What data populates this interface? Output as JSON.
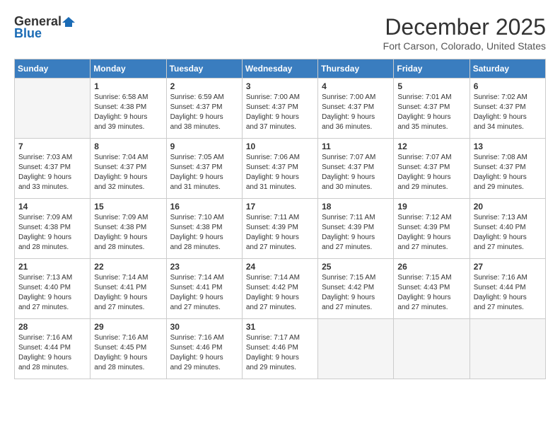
{
  "header": {
    "logo_line1": "General",
    "logo_line2": "Blue",
    "month": "December 2025",
    "location": "Fort Carson, Colorado, United States"
  },
  "days_of_week": [
    "Sunday",
    "Monday",
    "Tuesday",
    "Wednesday",
    "Thursday",
    "Friday",
    "Saturday"
  ],
  "weeks": [
    [
      {
        "day": "",
        "empty": true
      },
      {
        "day": "1",
        "sunrise": "6:58 AM",
        "sunset": "4:38 PM",
        "daylight": "9 hours and 39 minutes."
      },
      {
        "day": "2",
        "sunrise": "6:59 AM",
        "sunset": "4:37 PM",
        "daylight": "9 hours and 38 minutes."
      },
      {
        "day": "3",
        "sunrise": "7:00 AM",
        "sunset": "4:37 PM",
        "daylight": "9 hours and 37 minutes."
      },
      {
        "day": "4",
        "sunrise": "7:00 AM",
        "sunset": "4:37 PM",
        "daylight": "9 hours and 36 minutes."
      },
      {
        "day": "5",
        "sunrise": "7:01 AM",
        "sunset": "4:37 PM",
        "daylight": "9 hours and 35 minutes."
      },
      {
        "day": "6",
        "sunrise": "7:02 AM",
        "sunset": "4:37 PM",
        "daylight": "9 hours and 34 minutes."
      }
    ],
    [
      {
        "day": "7",
        "sunrise": "7:03 AM",
        "sunset": "4:37 PM",
        "daylight": "9 hours and 33 minutes."
      },
      {
        "day": "8",
        "sunrise": "7:04 AM",
        "sunset": "4:37 PM",
        "daylight": "9 hours and 32 minutes."
      },
      {
        "day": "9",
        "sunrise": "7:05 AM",
        "sunset": "4:37 PM",
        "daylight": "9 hours and 31 minutes."
      },
      {
        "day": "10",
        "sunrise": "7:06 AM",
        "sunset": "4:37 PM",
        "daylight": "9 hours and 31 minutes."
      },
      {
        "day": "11",
        "sunrise": "7:07 AM",
        "sunset": "4:37 PM",
        "daylight": "9 hours and 30 minutes."
      },
      {
        "day": "12",
        "sunrise": "7:07 AM",
        "sunset": "4:37 PM",
        "daylight": "9 hours and 29 minutes."
      },
      {
        "day": "13",
        "sunrise": "7:08 AM",
        "sunset": "4:37 PM",
        "daylight": "9 hours and 29 minutes."
      }
    ],
    [
      {
        "day": "14",
        "sunrise": "7:09 AM",
        "sunset": "4:38 PM",
        "daylight": "9 hours and 28 minutes."
      },
      {
        "day": "15",
        "sunrise": "7:09 AM",
        "sunset": "4:38 PM",
        "daylight": "9 hours and 28 minutes."
      },
      {
        "day": "16",
        "sunrise": "7:10 AM",
        "sunset": "4:38 PM",
        "daylight": "9 hours and 28 minutes."
      },
      {
        "day": "17",
        "sunrise": "7:11 AM",
        "sunset": "4:39 PM",
        "daylight": "9 hours and 27 minutes."
      },
      {
        "day": "18",
        "sunrise": "7:11 AM",
        "sunset": "4:39 PM",
        "daylight": "9 hours and 27 minutes."
      },
      {
        "day": "19",
        "sunrise": "7:12 AM",
        "sunset": "4:39 PM",
        "daylight": "9 hours and 27 minutes."
      },
      {
        "day": "20",
        "sunrise": "7:13 AM",
        "sunset": "4:40 PM",
        "daylight": "9 hours and 27 minutes."
      }
    ],
    [
      {
        "day": "21",
        "sunrise": "7:13 AM",
        "sunset": "4:40 PM",
        "daylight": "9 hours and 27 minutes."
      },
      {
        "day": "22",
        "sunrise": "7:14 AM",
        "sunset": "4:41 PM",
        "daylight": "9 hours and 27 minutes."
      },
      {
        "day": "23",
        "sunrise": "7:14 AM",
        "sunset": "4:41 PM",
        "daylight": "9 hours and 27 minutes."
      },
      {
        "day": "24",
        "sunrise": "7:14 AM",
        "sunset": "4:42 PM",
        "daylight": "9 hours and 27 minutes."
      },
      {
        "day": "25",
        "sunrise": "7:15 AM",
        "sunset": "4:42 PM",
        "daylight": "9 hours and 27 minutes."
      },
      {
        "day": "26",
        "sunrise": "7:15 AM",
        "sunset": "4:43 PM",
        "daylight": "9 hours and 27 minutes."
      },
      {
        "day": "27",
        "sunrise": "7:16 AM",
        "sunset": "4:44 PM",
        "daylight": "9 hours and 27 minutes."
      }
    ],
    [
      {
        "day": "28",
        "sunrise": "7:16 AM",
        "sunset": "4:44 PM",
        "daylight": "9 hours and 28 minutes."
      },
      {
        "day": "29",
        "sunrise": "7:16 AM",
        "sunset": "4:45 PM",
        "daylight": "9 hours and 28 minutes."
      },
      {
        "day": "30",
        "sunrise": "7:16 AM",
        "sunset": "4:46 PM",
        "daylight": "9 hours and 29 minutes."
      },
      {
        "day": "31",
        "sunrise": "7:17 AM",
        "sunset": "4:46 PM",
        "daylight": "9 hours and 29 minutes."
      },
      {
        "day": "",
        "empty": true
      },
      {
        "day": "",
        "empty": true
      },
      {
        "day": "",
        "empty": true
      }
    ]
  ]
}
